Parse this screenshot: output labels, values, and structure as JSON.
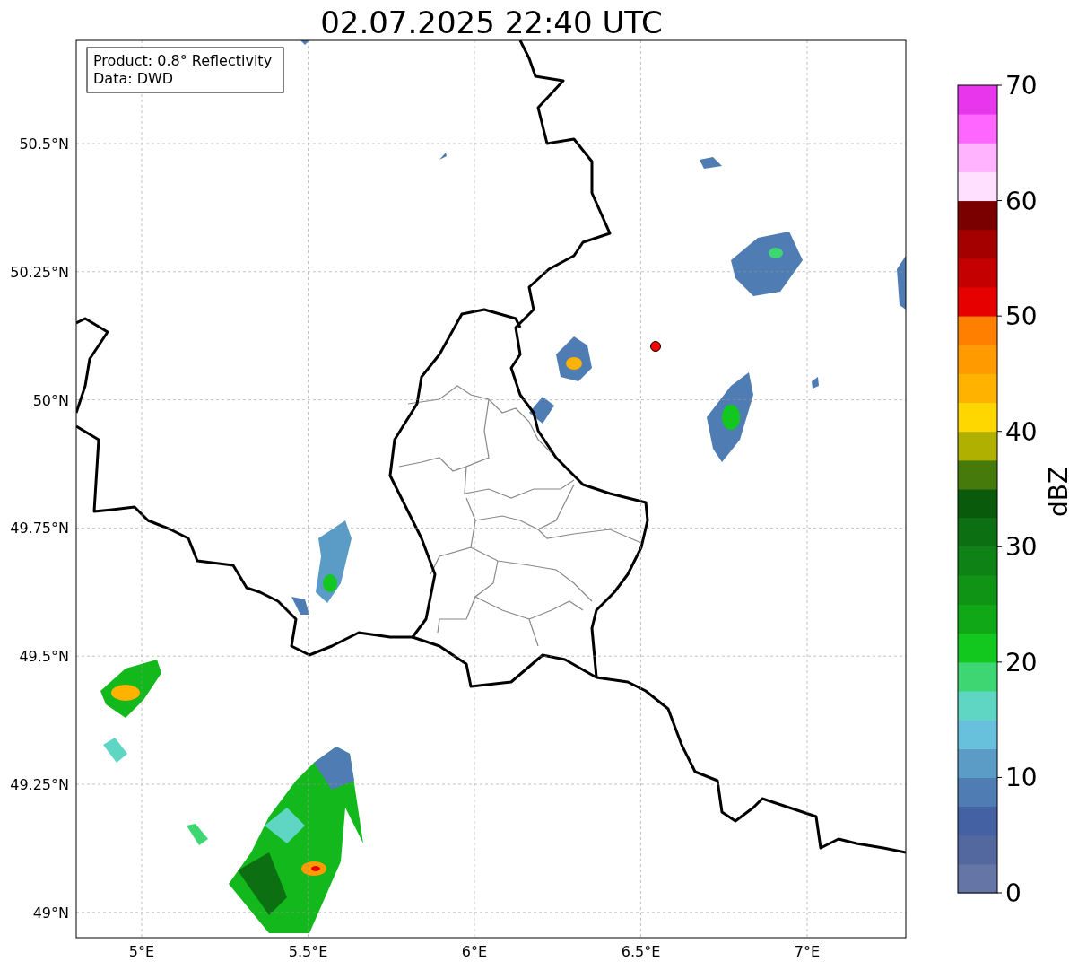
{
  "title": "02.07.2025 22:40 UTC",
  "info_box": [
    "Product: 0.8° Reflectivity",
    "Data: DWD"
  ],
  "y_ticks": [
    "50.5°N",
    "50.25°N",
    "50°N",
    "49.75°N",
    "49.5°N",
    "49.25°N",
    "49°N"
  ],
  "x_ticks": [
    "5°E",
    "5.5°E",
    "6°E",
    "6.5°E",
    "7°E"
  ],
  "colorbar": {
    "label": "dBZ",
    "ticks": [
      "70",
      "60",
      "50",
      "40",
      "30",
      "20",
      "10",
      "0"
    ],
    "levels": [
      {
        "color": "#6575a6"
      },
      {
        "color": "#5468a0"
      },
      {
        "color": "#4461a3"
      },
      {
        "color": "#4e7cb3"
      },
      {
        "color": "#5a9cc5"
      },
      {
        "color": "#67c1dc"
      },
      {
        "color": "#5fd6c3"
      },
      {
        "color": "#3dd672"
      },
      {
        "color": "#12c81e"
      },
      {
        "color": "#11a818"
      },
      {
        "color": "#0f9416"
      },
      {
        "color": "#0e8214"
      },
      {
        "color": "#0c7012"
      },
      {
        "color": "#0a5a0b"
      },
      {
        "color": "#467a0a"
      },
      {
        "color": "#b0b000"
      },
      {
        "color": "#ffd700"
      },
      {
        "color": "#ffb300"
      },
      {
        "color": "#ff9a00"
      },
      {
        "color": "#ff7f00"
      },
      {
        "color": "#e60000"
      },
      {
        "color": "#c40000"
      },
      {
        "color": "#a50000"
      },
      {
        "color": "#7a0000"
      },
      {
        "color": "#ffe0ff"
      },
      {
        "color": "#ffb3ff"
      },
      {
        "color": "#ff66ff"
      },
      {
        "color": "#e836ec"
      }
    ]
  }
}
